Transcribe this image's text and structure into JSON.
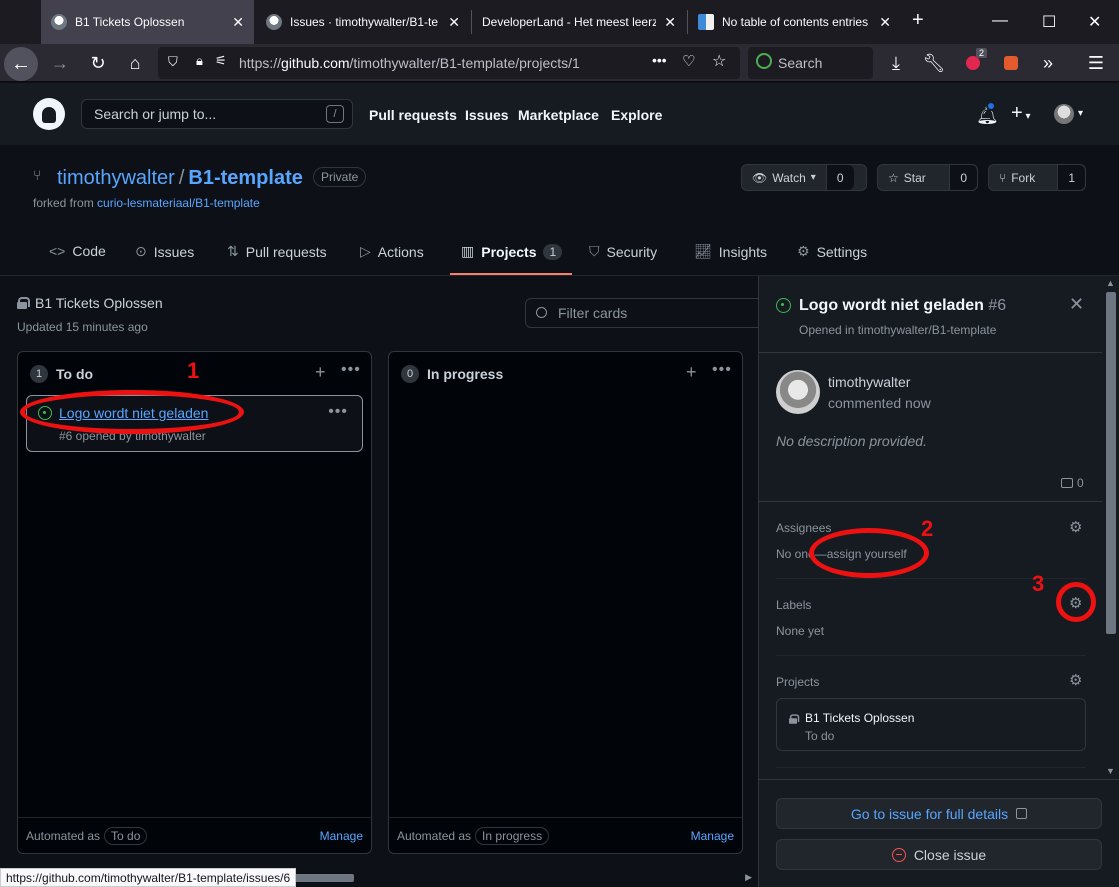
{
  "browser": {
    "tabs": [
      {
        "label": "B1 Tickets Oplossen",
        "active": true
      },
      {
        "label": "Issues · timothywalter/B1-te",
        "active": false
      },
      {
        "label": "DeveloperLand - Het meest leerz",
        "active": false
      },
      {
        "label": "No table of contents entries",
        "active": false
      }
    ],
    "new_tab": "+",
    "url_prefix": "https://",
    "url_domain": "github.com",
    "url_path": "/timothywalter/B1-template/projects/1",
    "search_placeholder": "Search",
    "extension_badge": "2",
    "status_url": "https://github.com/timothywalter/B1-template/issues/6"
  },
  "github": {
    "search_placeholder": "Search or jump to...",
    "search_shortcut": "/",
    "nav": [
      "Pull requests",
      "Issues",
      "Marketplace",
      "Explore"
    ]
  },
  "repo": {
    "owner": "timothywalter",
    "separator": "/",
    "name": "B1-template",
    "visibility": "Private",
    "forked_from_prefix": "forked from",
    "forked_from": "curio-lesmateriaal/B1-template",
    "watch_label": "Watch",
    "watch_count": "0",
    "star_label": "Star",
    "star_count": "0",
    "fork_label": "Fork",
    "fork_count": "1",
    "tabs": {
      "code": "Code",
      "issues": "Issues",
      "pulls": "Pull requests",
      "actions": "Actions",
      "projects": "Projects",
      "projects_count": "1",
      "security": "Security",
      "insights": "Insights",
      "settings": "Settings"
    }
  },
  "project": {
    "title": "B1 Tickets Oplossen",
    "updated": "Updated 15 minutes ago",
    "filter_placeholder": "Filter cards",
    "columns": [
      {
        "count": "1",
        "name": "To do",
        "automated_prefix": "Automated as",
        "automated_as": "To do",
        "manage": "Manage",
        "cards": [
          {
            "title": "Logo wordt niet geladen",
            "subtitle": "#6 opened by timothywalter"
          }
        ]
      },
      {
        "count": "0",
        "name": "In progress",
        "automated_prefix": "Automated as",
        "automated_as": "In progress",
        "manage": "Manage",
        "cards": []
      }
    ]
  },
  "panel": {
    "issue_title": "Logo wordt niet geladen",
    "issue_number": "#6",
    "opened_in": "Opened in timothywalter/B1-template",
    "commenter": "timothywalter",
    "commented": "commented now",
    "description": "No description provided.",
    "comment_count": "0",
    "assignees_label": "Assignees",
    "assignees_value": "No one—assign yourself",
    "labels_label": "Labels",
    "labels_value": "None yet",
    "projects_label": "Projects",
    "project_name": "B1 Tickets Oplossen",
    "project_column": "To do",
    "go_to_issue": "Go to issue for full details",
    "close_issue": "Close issue"
  },
  "annotations": {
    "one": "1",
    "two": "2",
    "three": "3",
    "color": "#ee1111"
  }
}
